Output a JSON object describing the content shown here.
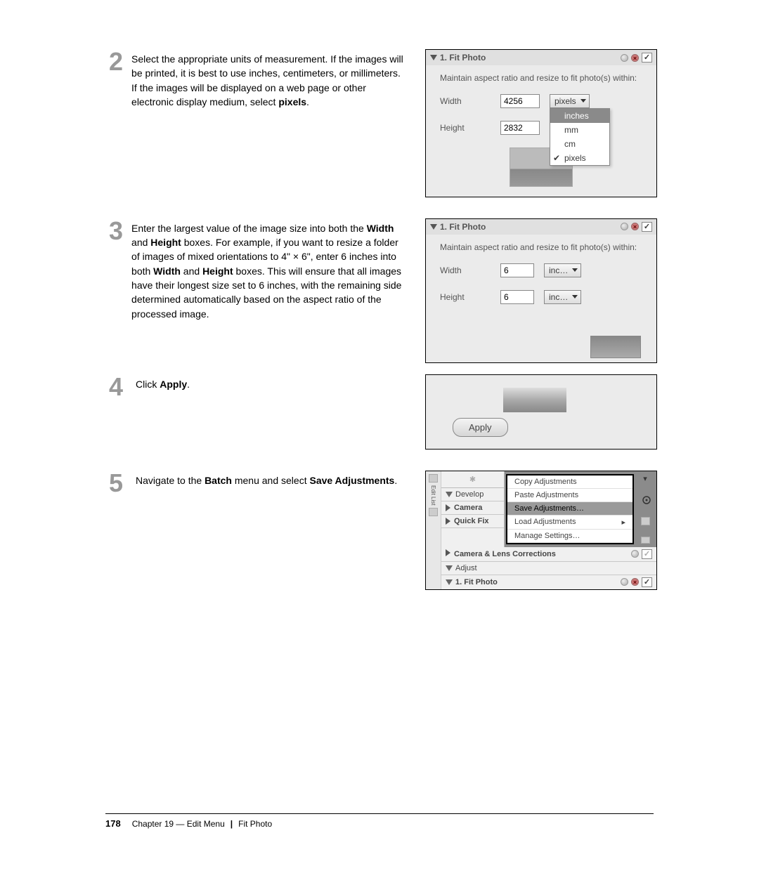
{
  "steps": {
    "s2": {
      "num": "2",
      "text_pre": "Select the appropriate units of measurement. If the images will be printed, it is best to use inches, centimeters, or millimeters. If the images will be displayed on a web page or other electronic display medium, select ",
      "bold": "pixels",
      "tail": "."
    },
    "s3": {
      "num": "3",
      "text": "Enter the largest value of the image size into both the <b>Width</b> and <b>Height</b> boxes. For example, if you want to resize a folder of images of mixed orientations to 4\" × 6\", enter 6 inches into both <b>Width</b> and <b>Height</b> boxes. This will ensure that all images have their longest size set to 6 inches, with the remaining side determined automatically based on the aspect ratio of the processed image."
    },
    "s4": {
      "num": "4",
      "text": "Click <b>Apply</b>."
    },
    "s5": {
      "num": "5",
      "text": "Navigate to the <b>Batch</b> menu and select <b>Save Adjustments</b>."
    }
  },
  "panel1": {
    "title": "1. Fit Photo",
    "subtitle": "Maintain aspect ratio and resize to fit photo(s) within:",
    "width_label": "Width",
    "width_val": "4256",
    "height_label": "Height",
    "height_val": "2832",
    "unit_sel": "pixels",
    "dropdown": [
      "inches",
      "mm",
      "cm",
      "pixels"
    ],
    "dropdown_selected": "inches",
    "dropdown_checked": "pixels"
  },
  "panel2": {
    "title": "1. Fit Photo",
    "subtitle": "Maintain aspect ratio and resize to fit photo(s) within:",
    "width_label": "Width",
    "width_val": "6",
    "height_label": "Height",
    "height_val": "6",
    "unit_label": "inc…"
  },
  "panel3": {
    "apply": "Apply"
  },
  "panel4": {
    "edit_list": "Edit List",
    "develop": "Develop",
    "camera": "Camera",
    "quickfix": "Quick Fix",
    "corrections": "Camera & Lens Corrections",
    "adjust": "Adjust",
    "fit_photo": "1. Fit Photo",
    "menu": {
      "copy": "Copy Adjustments",
      "paste": "Paste Adjustments",
      "save": "Save Adjustments…",
      "load": "Load Adjustments",
      "manage": "Manage Settings…"
    }
  },
  "footer": {
    "page": "178",
    "chapter": "Chapter 19 — Edit Menu",
    "section": "Fit Photo"
  }
}
